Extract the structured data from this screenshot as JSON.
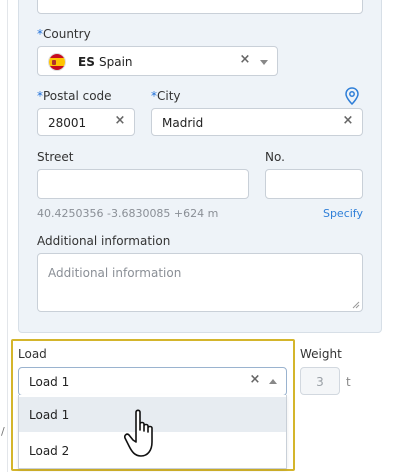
{
  "country": {
    "label": "Country",
    "required_mark": "*",
    "code": "ES",
    "name": "Spain"
  },
  "postal_code": {
    "label": "Postal code",
    "required_mark": "*",
    "value": "28001"
  },
  "city": {
    "label": "City",
    "required_mark": "*",
    "value": "Madrid"
  },
  "street": {
    "label": "Street",
    "value": ""
  },
  "number": {
    "label": "No.",
    "value": ""
  },
  "coordinates": "40.4250356 -3.6830085 +624 m",
  "specify_link": "Specify",
  "additional_info": {
    "label": "Additional information",
    "placeholder": "Additional information"
  },
  "load": {
    "label": "Load",
    "selected": "Load 1",
    "options": [
      "Load 1",
      "Load 2"
    ]
  },
  "weight": {
    "label": "Weight",
    "value": "3",
    "unit": "t"
  },
  "colors": {
    "accent": "#1e6fd9",
    "link": "#2f7fd8",
    "highlight": "#d4b52b",
    "panel": "#eef3f8"
  },
  "icons": {
    "clear": "close-icon",
    "caret": "chevron-down-icon",
    "pin": "map-pin-icon",
    "cursor": "hand-pointer-icon"
  }
}
